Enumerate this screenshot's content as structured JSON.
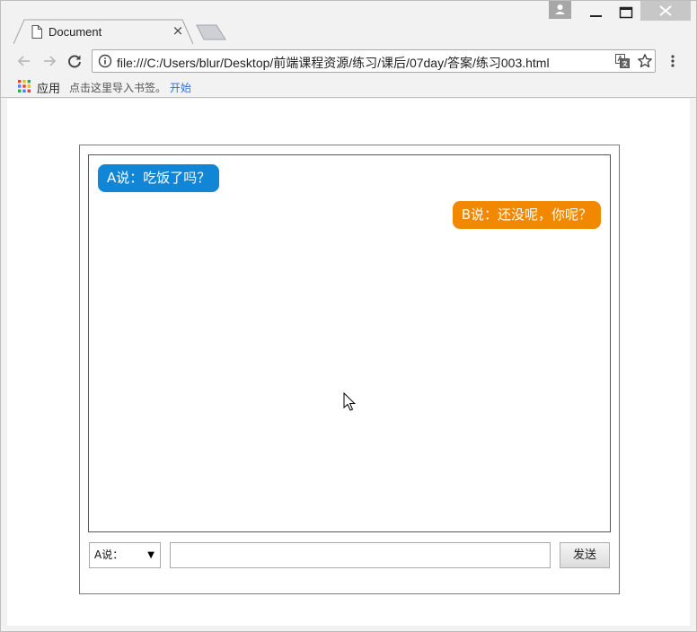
{
  "browser": {
    "tab": {
      "title": "Document",
      "close_glyph": "×",
      "icon": "document-icon"
    },
    "address": {
      "url": "file:///C:/Users/blur/Desktop/前端课程资源/练习/课后/07day/答案/练习003.html"
    },
    "bookmarks": {
      "apps_label": "应用",
      "import_text": "点击这里导入书签。",
      "start_link": "开始"
    },
    "icons": [
      "back-icon",
      "forward-icon",
      "reload-icon",
      "info-icon",
      "translate-icon",
      "star-icon",
      "menu-icon",
      "apps-grid-icon",
      "profile-icon",
      "minimize-icon",
      "maximize-icon",
      "close-icon"
    ]
  },
  "chat": {
    "messages": [
      {
        "speaker": "A",
        "text": "A说：吃饭了吗？",
        "color": "#1185d6",
        "align": "left"
      },
      {
        "speaker": "B",
        "text": "B说：还没呢，你呢？",
        "color": "#f28800",
        "align": "right"
      }
    ],
    "speaker_select": {
      "selected": "A说："
    },
    "input_value": "",
    "send_label": "发送"
  }
}
